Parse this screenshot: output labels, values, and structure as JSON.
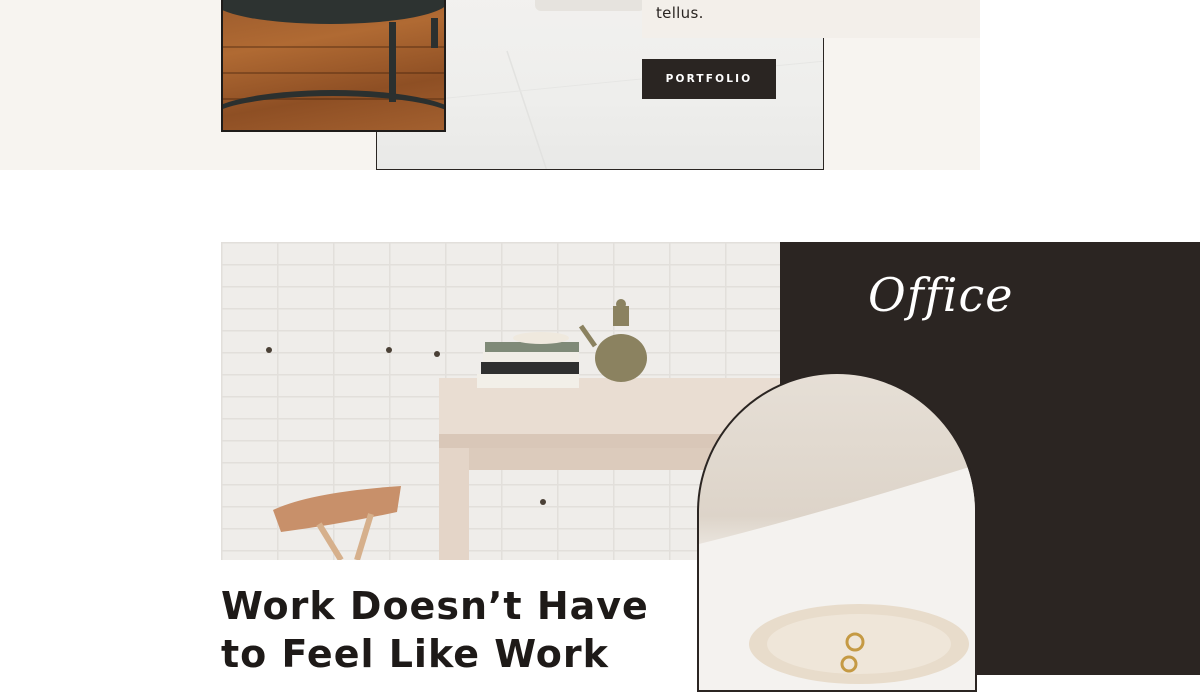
{
  "hero": {
    "quote_text": "tellus.",
    "portfolio_button": "PORTFOLIO"
  },
  "office": {
    "script_title": "Office",
    "heading_line1": "Work Doesn’t Have",
    "heading_line2": "to Feel Like Work"
  },
  "colors": {
    "dark": "#2b2522",
    "cream": "#f7f4f0",
    "text": "#1e1a18",
    "white": "#ffffff"
  }
}
